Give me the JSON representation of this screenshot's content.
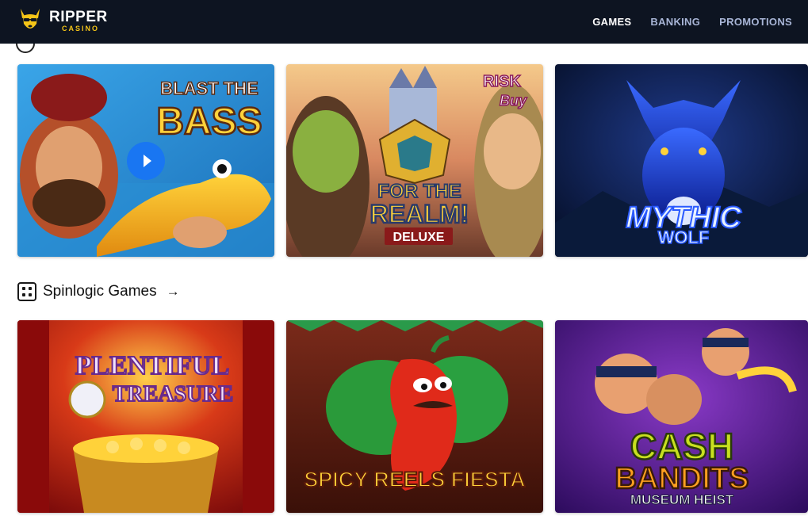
{
  "header": {
    "logo_main": "RIPPER",
    "logo_sub": "CASINO",
    "nav": [
      {
        "label": "GAMES",
        "active": true
      },
      {
        "label": "BANKING",
        "active": false
      },
      {
        "label": "PROMOTIONS",
        "active": false
      }
    ]
  },
  "section_spinlogic": {
    "title": "Spinlogic Games",
    "icon": "dice-icon",
    "arrow": "→"
  },
  "games_row1": [
    {
      "title_line1": "BLAST THE",
      "title_line2": "BASS",
      "has_play": true
    },
    {
      "badge_line1": "RISK",
      "badge_line2": "Buy",
      "title_line1": "FOR THE",
      "title_line2": "REALM!",
      "subtitle": "DELUXE"
    },
    {
      "title_line1": "MYTHIC",
      "title_line2": "WOLF"
    }
  ],
  "games_row2": [
    {
      "title_line1": "PLENTIFUL",
      "title_line2": "TREASURE"
    },
    {
      "title": "SPICY REELS FIESTA"
    },
    {
      "title_line1": "CASH",
      "title_line2": "BANDITS",
      "subtitle": "MUSEUM HEIST"
    }
  ],
  "colors": {
    "header_bg": "#0d1421",
    "nav_active": "#ffffff",
    "nav_inactive": "#a8b5d6",
    "play_button": "#1976f2",
    "logo_accent": "#f5c518"
  }
}
